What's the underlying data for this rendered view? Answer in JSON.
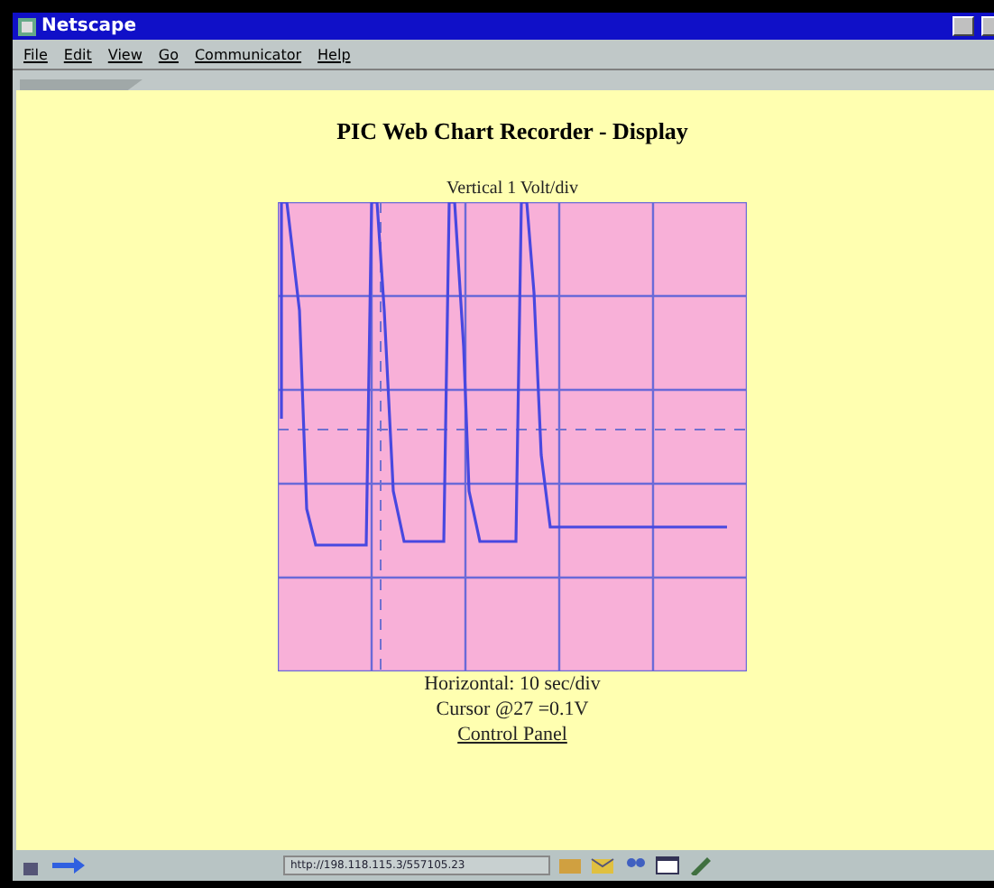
{
  "window": {
    "title": "Netscape"
  },
  "menu": [
    "File",
    "Edit",
    "View",
    "Go",
    "Communicator",
    "Help"
  ],
  "page": {
    "heading": "PIC Web Chart Recorder - Display",
    "vertical_label": "Vertical 1 Volt/div",
    "horizontal_label": "Horizontal: 10 sec/div",
    "cursor_label": "Cursor @27 =0.1V",
    "link": "Control Panel"
  },
  "status_bar": {
    "url": "http://198.118.115.3/557105.23"
  }
}
